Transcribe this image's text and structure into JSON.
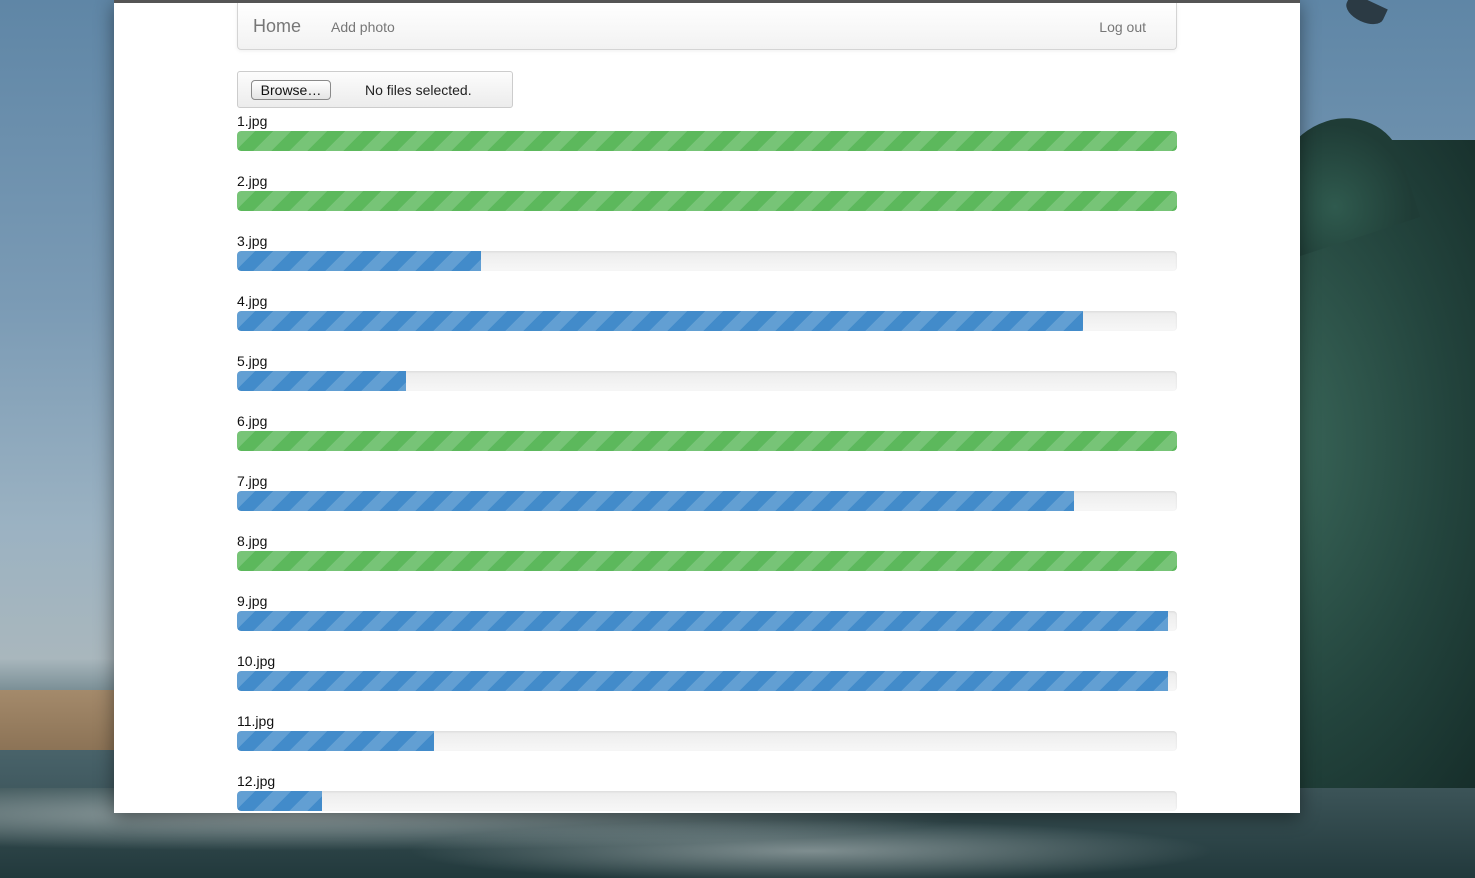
{
  "nav": {
    "brand": "Home",
    "add_photo": "Add photo",
    "logout": "Log out"
  },
  "file_input": {
    "button_label": "Browse…",
    "status": "No files selected."
  },
  "colors": {
    "complete": "#5cb85c",
    "in_progress": "#428bca"
  },
  "uploads": [
    {
      "name": "1.jpg",
      "progress": 100,
      "state": "complete"
    },
    {
      "name": "2.jpg",
      "progress": 100,
      "state": "complete"
    },
    {
      "name": "3.jpg",
      "progress": 26,
      "state": "in_progress"
    },
    {
      "name": "4.jpg",
      "progress": 90,
      "state": "in_progress"
    },
    {
      "name": "5.jpg",
      "progress": 18,
      "state": "in_progress"
    },
    {
      "name": "6.jpg",
      "progress": 100,
      "state": "complete"
    },
    {
      "name": "7.jpg",
      "progress": 89,
      "state": "in_progress"
    },
    {
      "name": "8.jpg",
      "progress": 100,
      "state": "complete"
    },
    {
      "name": "9.jpg",
      "progress": 99,
      "state": "in_progress"
    },
    {
      "name": "10.jpg",
      "progress": 99,
      "state": "in_progress"
    },
    {
      "name": "11.jpg",
      "progress": 21,
      "state": "in_progress"
    },
    {
      "name": "12.jpg",
      "progress": 9,
      "state": "in_progress"
    }
  ]
}
